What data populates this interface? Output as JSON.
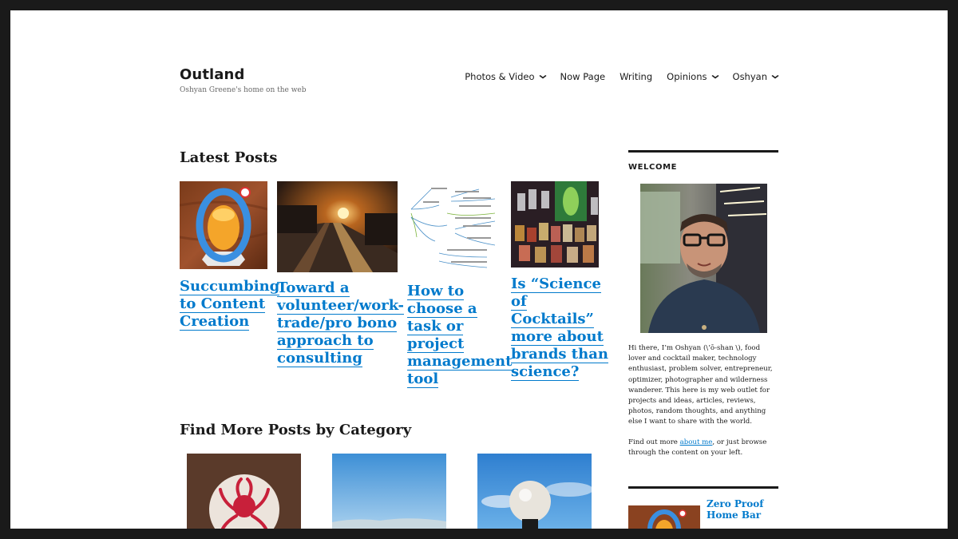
{
  "site": {
    "title": "Outland",
    "tagline": "Oshyan Greene's home on the web"
  },
  "nav": {
    "items": [
      {
        "label": "Photos & Video",
        "has_submenu": true
      },
      {
        "label": "Now Page",
        "has_submenu": false
      },
      {
        "label": "Writing",
        "has_submenu": false
      },
      {
        "label": "Opinions",
        "has_submenu": true
      },
      {
        "label": "Oshyan",
        "has_submenu": true
      }
    ],
    "chevron": "⌄"
  },
  "latest": {
    "heading": "Latest Posts",
    "posts": [
      {
        "title_lines": [
          "Succumbing",
          "to Content",
          "Creation"
        ],
        "thumb": "orange-cocktail-logo-photo"
      },
      {
        "title_lines": [
          "Toward a",
          "volunteer/work-",
          "trade/pro bono",
          "approach to",
          "consulting"
        ],
        "thumb": "sunset-train-tracks-photo"
      },
      {
        "title_lines": [
          "How to",
          "choose a",
          "task or",
          "project",
          "management",
          "tool"
        ],
        "thumb": "mind-map-diagram-image"
      },
      {
        "title_lines": [
          "Is “Science",
          "of",
          "Cocktails”",
          "more about",
          "brands than",
          "science?"
        ],
        "thumb": "cocktail-glasses-bar-photo"
      }
    ]
  },
  "categories": {
    "heading": "Find More Posts by Category",
    "items": [
      {
        "thumb": "octopus-coaster-photo"
      },
      {
        "thumb": "blue-sky-landscape-photo"
      },
      {
        "thumb": "street-lamp-sky-photo"
      }
    ]
  },
  "sidebar": {
    "welcome_title": "WELCOME",
    "portrait": "portrait-photo",
    "bio": "Hi there, I’m Oshyan (\\’ō-shan \\), food lover and cocktail maker, technology enthusiast, problem solver, entrepreneur, optimizer, photographer and wilderness wanderer. This here is my web outlet for projects and ideas, articles, reviews, photos, random thoughts, and anything else I want to share with the world.",
    "more_prefix": "Find out more ",
    "more_link": "about me",
    "more_suffix": ", or just browse through the content on your left.",
    "next_post_title": "Zero Proof Home Bar",
    "next_post_thumb": "orange-cocktail-logo-photo"
  },
  "colors": {
    "link": "#007acc",
    "text": "#1a1a1a",
    "frame": "#1a1a1a",
    "background": "#ffffff"
  }
}
